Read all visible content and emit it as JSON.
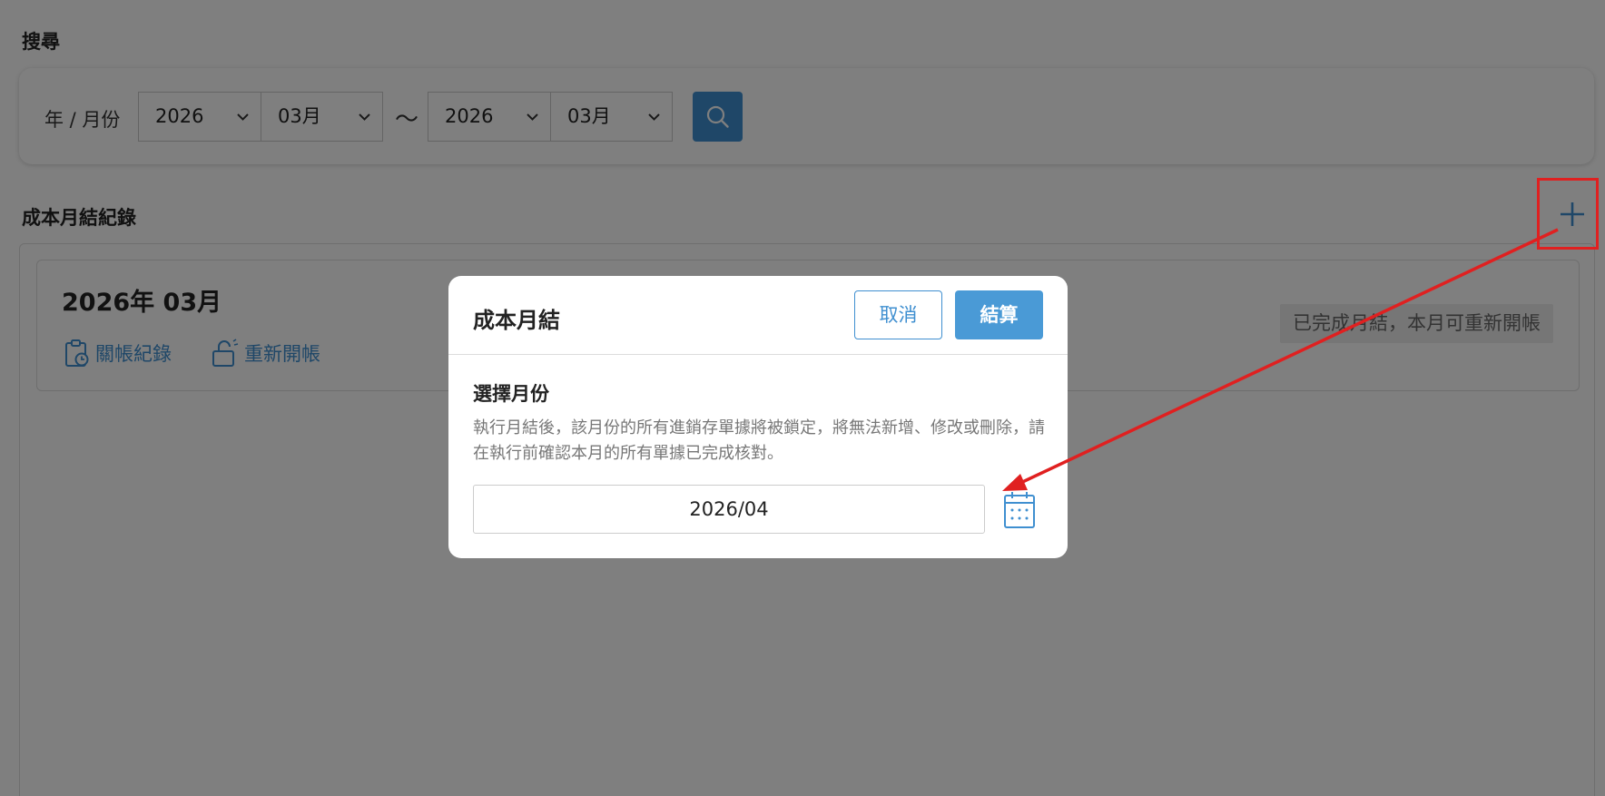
{
  "search": {
    "title": "搜尋",
    "period_label": "年 / 月份",
    "from_year": "2026",
    "from_month": "03月",
    "range_separator": "～",
    "to_year": "2026",
    "to_month": "03月",
    "search_icon": "search-icon"
  },
  "records": {
    "title": "成本月結紀錄",
    "add_icon": "plus-icon",
    "items": [
      {
        "period": "2026年 03月",
        "actions": [
          {
            "label": "關帳紀錄",
            "icon": "clipboard-clock-icon"
          },
          {
            "label": "重新開帳",
            "icon": "unlock-icon"
          }
        ],
        "status": "已完成月結，本月可重新開帳"
      }
    ]
  },
  "modal": {
    "title": "成本月結",
    "cancel_label": "取消",
    "confirm_label": "結算",
    "subtitle": "選擇月份",
    "description": "執行月結後，該月份的所有進銷存單據將被鎖定，將無法新增、修改或刪除，請在執行前確認本月的所有單據已完成核對。",
    "month_value": "2026/04",
    "calendar_icon": "calendar-icon"
  },
  "colors": {
    "accent": "#3f8fd0",
    "annotation": "#e02020",
    "overlay": "rgba(0,0,0,0.5)"
  }
}
